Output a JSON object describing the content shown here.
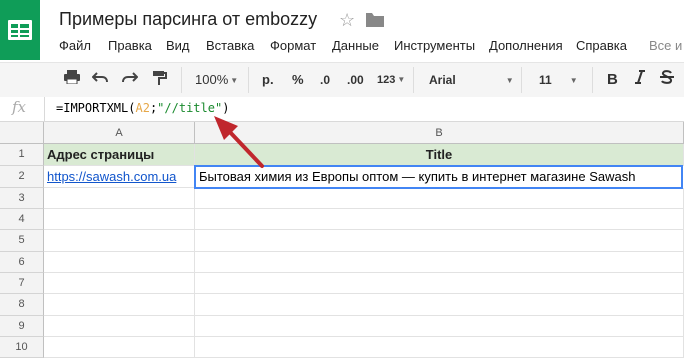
{
  "app": {
    "title": "Примеры парсинга от embozzy"
  },
  "menu": [
    "Файл",
    "Правка",
    "Вид",
    "Вставка",
    "Формат",
    "Данные",
    "Инструменты",
    "Дополнения",
    "Справка",
    "Все и"
  ],
  "toolbar": {
    "zoom": "100%",
    "currency": "р.",
    "percent": "%",
    "decrease_decimals": ".0",
    "increase_decimals": ".00",
    "more_formats": "123",
    "font": "Arial",
    "font_size": "11",
    "bold": "B"
  },
  "formula_bar": {
    "fx": "fx",
    "prefix": "=IMPORTXML(",
    "ref": "A2",
    "sep": ";",
    "xpath": "\"//title\"",
    "suffix": ")"
  },
  "grid": {
    "columns": [
      "A",
      "B"
    ],
    "rows": [
      "1",
      "2",
      "3",
      "4",
      "5",
      "6",
      "7",
      "8",
      "9",
      "10"
    ],
    "cells": {
      "a1": "Адрес страницы",
      "b1": "Title",
      "a2": "https://sawash.com.ua",
      "b2": "Бытовая химия из Европы оптом — купить в интернет магазине Sawash"
    }
  },
  "annotation": {
    "arrow_color": "#c0272d"
  },
  "colors": {
    "logo": "#0f9d58",
    "header_row": "#d9ead3",
    "link": "#1155cc",
    "selection": "#4285f4"
  }
}
